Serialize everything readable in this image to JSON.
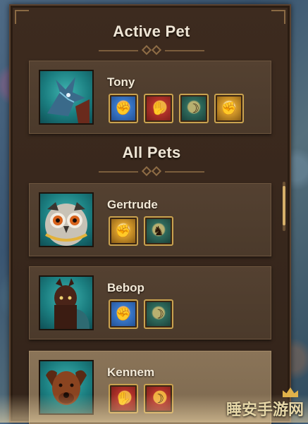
{
  "active_section": {
    "title": "Active Pet"
  },
  "all_section": {
    "title": "All Pets"
  },
  "active_pet": {
    "name": "Tony",
    "portrait": "dragon-portrait",
    "abilities": [
      {
        "icon": "blue-claw-ability-icon",
        "color": "#3a78c9"
      },
      {
        "icon": "red-beast-ability-icon",
        "color": "#b2322a"
      },
      {
        "icon": "teal-horn-ability-icon",
        "color": "#2f6a5c"
      },
      {
        "icon": "gold-fist-ability-icon",
        "color": "#d59a2a"
      }
    ]
  },
  "pets": [
    {
      "name": "Gertrude",
      "portrait": "owl-portrait",
      "abilities": [
        {
          "icon": "gold-fist-ability-icon",
          "color": "#d59a2a"
        },
        {
          "icon": "teal-shadow-ability-icon",
          "color": "#2f6a5c"
        }
      ]
    },
    {
      "name": "Bebop",
      "portrait": "alpaca-portrait",
      "abilities": [
        {
          "icon": "blue-claw-ability-icon",
          "color": "#3a78c9"
        },
        {
          "icon": "teal-horn-ability-icon",
          "color": "#2f6a5c"
        }
      ]
    },
    {
      "name": "Kennem",
      "portrait": "dog-portrait",
      "abilities": [
        {
          "icon": "red-beast-ability-icon",
          "color": "#b2322a"
        },
        {
          "icon": "red-horn-ability-icon",
          "color": "#b2322a"
        }
      ]
    }
  ],
  "watermark": "睡安手游网",
  "colors": {
    "panel": "#3d2b1f",
    "card": "#544131",
    "selected_card": "#8a7458",
    "ability_border": "#c9a24f",
    "title_text": "#efe6d6"
  }
}
